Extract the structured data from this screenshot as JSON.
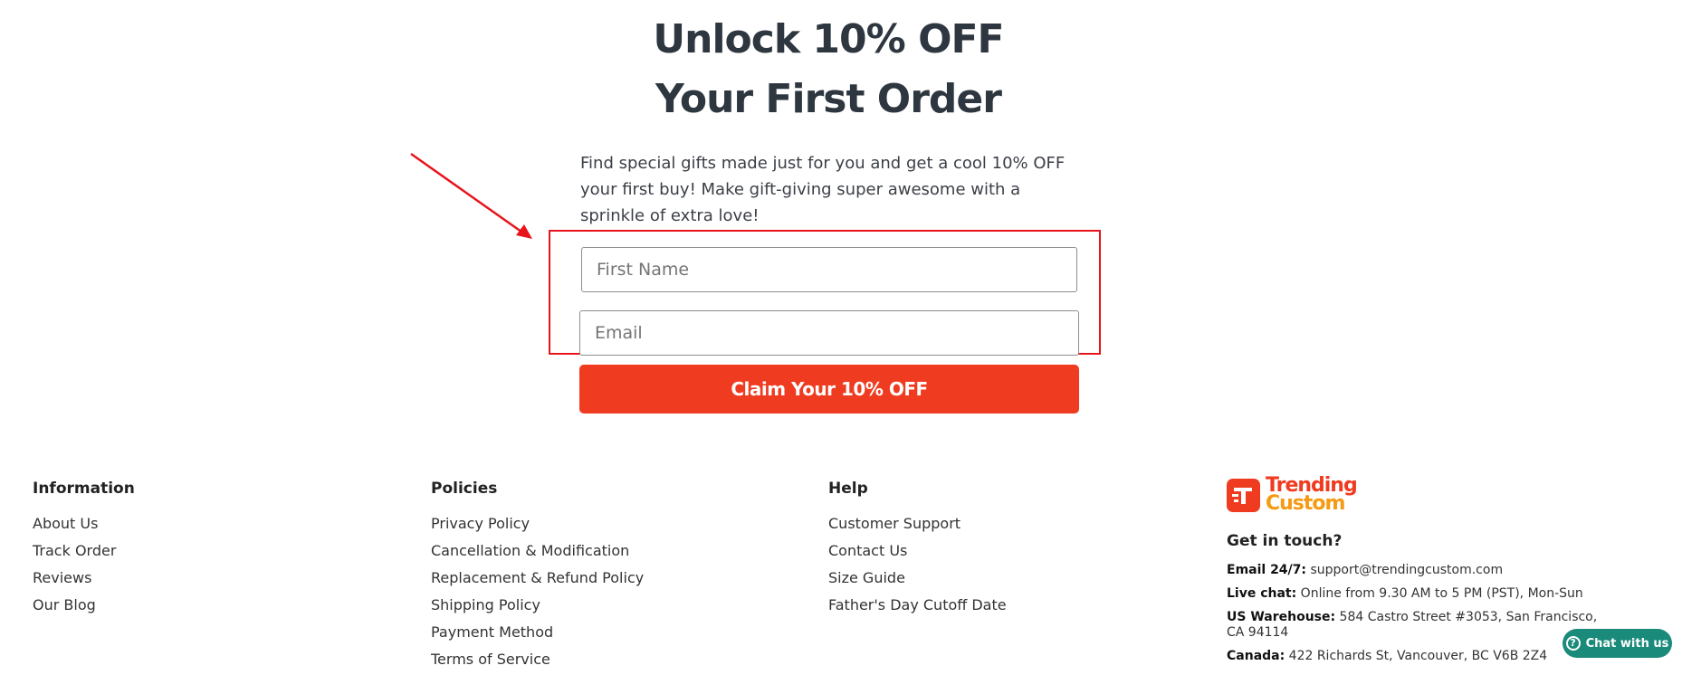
{
  "hero": {
    "title_line1": "Unlock 10% OFF",
    "title_line2": "Your First Order",
    "intro": "Find special gifts made just for you and get a cool 10% OFF your first buy! Make gift-giving super awesome with a sprinkle of extra love!"
  },
  "form": {
    "first_name_placeholder": "First Name",
    "email_placeholder": "Email",
    "cta_label": "Claim Your 10% OFF"
  },
  "footer": {
    "information": {
      "heading": "Information",
      "links": [
        "About Us",
        "Track Order",
        "Reviews",
        "Our Blog"
      ]
    },
    "policies": {
      "heading": "Policies",
      "links": [
        "Privacy Policy",
        "Cancellation & Modification",
        "Replacement & Refund Policy",
        "Shipping Policy",
        "Payment Method",
        "Terms of Service"
      ]
    },
    "help": {
      "heading": "Help",
      "links": [
        "Customer Support",
        "Contact Us",
        "Size Guide",
        "Father's Day Cutoff Date"
      ]
    },
    "brand": {
      "line1": "Trending",
      "line2": "Custom",
      "get_in_touch": "Get in touch?",
      "email_label": "Email 24/7:",
      "email_value": "support@trendingcustom.com",
      "chat_label": "Live chat:",
      "chat_value": "Online from 9.30 AM to 5 PM (PST), Mon-Sun",
      "us_label": "US Warehouse:",
      "us_value": "584 Castro Street #3053, San Francisco, CA 94114",
      "canada_label": "Canada:",
      "canada_value": "422 Richards St, Vancouver, BC V6B 2Z4"
    }
  },
  "chat_widget": {
    "label": "Chat with us"
  },
  "colors": {
    "accent": "#ef3b20",
    "annotation": "#e8141c",
    "chat": "#1a8a7a",
    "brand_secondary": "#f59a12"
  }
}
